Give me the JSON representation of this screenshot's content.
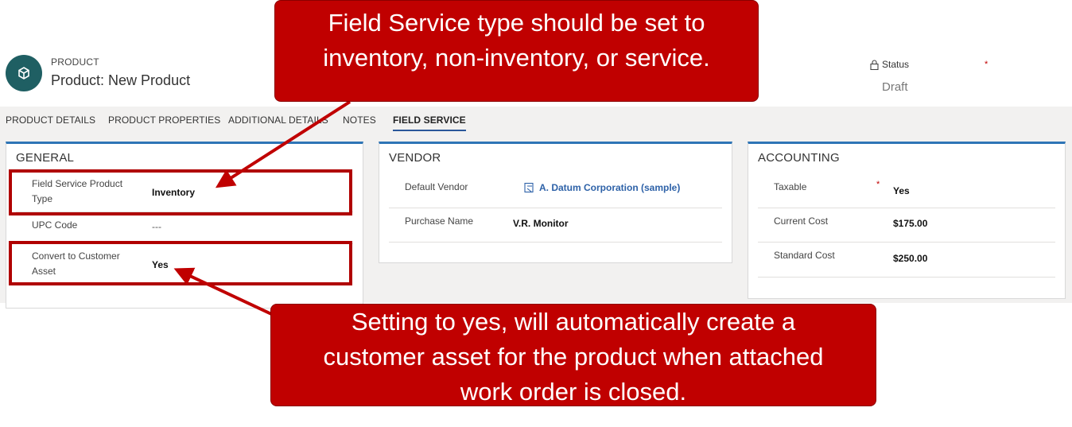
{
  "header": {
    "entity_label": "PRODUCT",
    "record_title": "Product: New Product",
    "status_label": "Status",
    "status_required": "*",
    "status_value": "Draft"
  },
  "tabs": [
    {
      "label": "PRODUCT DETAILS"
    },
    {
      "label": "PRODUCT PROPERTIES"
    },
    {
      "label": "ADDITIONAL DETAILS"
    },
    {
      "label": "NOTES"
    },
    {
      "label": "FIELD SERVICE",
      "active": true
    }
  ],
  "general": {
    "title": "GENERAL",
    "fields": [
      {
        "label_line1": "Field Service Product",
        "label_line2": "Type",
        "value": "Inventory"
      },
      {
        "label": "UPC Code",
        "value": "---"
      },
      {
        "label_line1": "Convert to Customer",
        "label_line2": "Asset",
        "value": "Yes"
      }
    ]
  },
  "vendor": {
    "title": "VENDOR",
    "fields": [
      {
        "label": "Default Vendor",
        "value": "A. Datum Corporation (sample)",
        "icon": "record-link-icon"
      },
      {
        "label": "Purchase Name",
        "value": "V.R. Monitor"
      }
    ]
  },
  "accounting": {
    "title": "ACCOUNTING",
    "fields": [
      {
        "label": "Taxable",
        "required": "*",
        "value": "Yes"
      },
      {
        "label": "Current Cost",
        "value": "$175.00"
      },
      {
        "label": "Standard Cost",
        "value": "$250.00"
      }
    ]
  },
  "callouts": {
    "top_line1": "Field Service type should be set to",
    "top_line2": "inventory, non-inventory, or service.",
    "bottom_line1": "Setting to yes, will automatically create a",
    "bottom_line2": "customer asset for the product when attached",
    "bottom_line3": "work order is closed."
  },
  "colors": {
    "accent_blue": "#2e75b6",
    "avatar_teal": "#1f5f63",
    "callout_red": "#c00000",
    "link_blue": "#2e62a8"
  }
}
